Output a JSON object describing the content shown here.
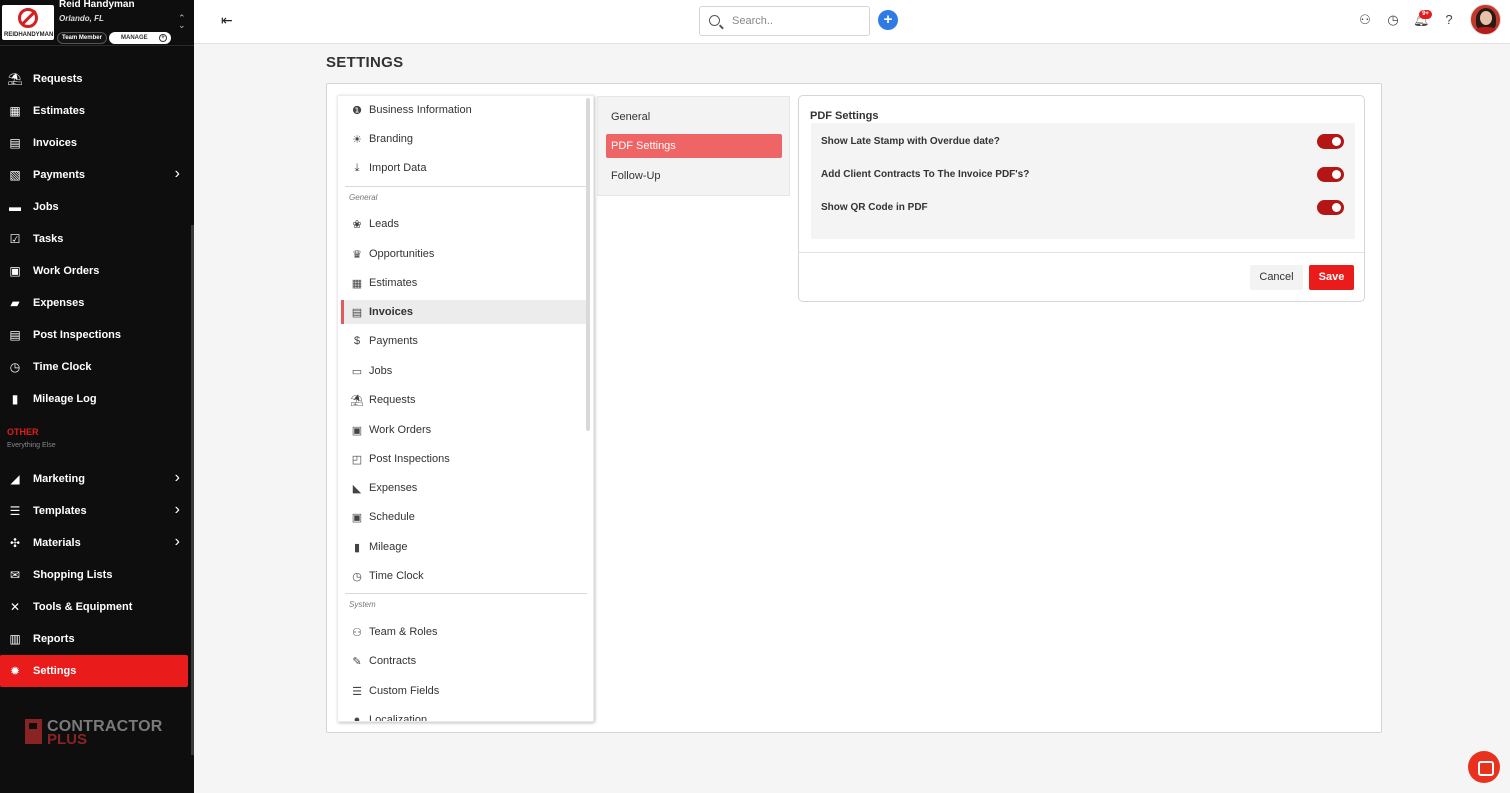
{
  "brand": {
    "business_name": "Reid Handyman",
    "location": "Orlando, FL",
    "role": "Team Member",
    "manage_label": "MANAGE",
    "logo_text": "REIDHANDYMAN"
  },
  "sidebar": {
    "items": [
      {
        "label": "Requests",
        "icon": "requests-icon",
        "glyph": "⛱"
      },
      {
        "label": "Estimates",
        "icon": "estimates-icon",
        "glyph": "▦"
      },
      {
        "label": "Invoices",
        "icon": "invoices-icon",
        "glyph": "▤"
      },
      {
        "label": "Payments",
        "icon": "payments-icon",
        "glyph": "▧",
        "has_submenu": true
      },
      {
        "label": "Jobs",
        "icon": "briefcase-icon",
        "glyph": "▬"
      },
      {
        "label": "Tasks",
        "icon": "checkbox-icon",
        "glyph": "☑"
      },
      {
        "label": "Work Orders",
        "icon": "work-orders-icon",
        "glyph": "▣"
      },
      {
        "label": "Expenses",
        "icon": "expenses-icon",
        "glyph": "▰"
      },
      {
        "label": "Post Inspections",
        "icon": "post-inspections-icon",
        "glyph": "▤"
      },
      {
        "label": "Time Clock",
        "icon": "clock-icon",
        "glyph": "◷"
      },
      {
        "label": "Mileage Log",
        "icon": "fuel-icon",
        "glyph": "▮"
      }
    ],
    "other_label": "OTHER",
    "other_sub": "Everything Else",
    "other_items": [
      {
        "label": "Marketing",
        "icon": "megaphone-icon",
        "glyph": "◢",
        "has_submenu": true
      },
      {
        "label": "Templates",
        "icon": "templates-icon",
        "glyph": "☰",
        "has_submenu": true
      },
      {
        "label": "Materials",
        "icon": "materials-icon",
        "glyph": "✣",
        "has_submenu": true
      },
      {
        "label": "Shopping Lists",
        "icon": "shopping-list-icon",
        "glyph": "✉"
      },
      {
        "label": "Tools & Equipment",
        "icon": "tools-icon",
        "glyph": "✕"
      },
      {
        "label": "Reports",
        "icon": "reports-icon",
        "glyph": "▥"
      },
      {
        "label": "Settings",
        "icon": "gear-icon",
        "glyph": "✹",
        "active": true
      }
    ],
    "footer_logo": {
      "line1": "CONTRACTOR",
      "line2": "PLUS"
    }
  },
  "topbar": {
    "search_placeholder": "Search.."
  },
  "notifications": {
    "badge": "9+"
  },
  "page": {
    "title": "SETTINGS"
  },
  "settings_menu": {
    "top_items": [
      {
        "label": "Business Information",
        "icon": "info-icon",
        "glyph": "❶"
      },
      {
        "label": "Branding",
        "icon": "sun-icon",
        "glyph": "☀"
      },
      {
        "label": "Import Data",
        "icon": "download-icon",
        "glyph": "⤓"
      }
    ],
    "general_label": "General",
    "general_items": [
      {
        "label": "Leads",
        "icon": "leads-icon",
        "glyph": "❀"
      },
      {
        "label": "Opportunities",
        "icon": "trophy-icon",
        "glyph": "♛"
      },
      {
        "label": "Estimates",
        "icon": "estimates-icon",
        "glyph": "▦"
      },
      {
        "label": "Invoices",
        "icon": "invoices-icon",
        "glyph": "▤",
        "active": true
      },
      {
        "label": "Payments",
        "icon": "payments-icon",
        "glyph": "$"
      },
      {
        "label": "Jobs",
        "icon": "briefcase-icon",
        "glyph": "▭"
      },
      {
        "label": "Requests",
        "icon": "requests-icon",
        "glyph": "⛱"
      },
      {
        "label": "Work Orders",
        "icon": "work-orders-icon",
        "glyph": "▣"
      },
      {
        "label": "Post Inspections",
        "icon": "post-inspections-icon",
        "glyph": "◰"
      },
      {
        "label": "Expenses",
        "icon": "expenses-icon",
        "glyph": "◣"
      },
      {
        "label": "Schedule",
        "icon": "calendar-icon",
        "glyph": "▣"
      },
      {
        "label": "Mileage",
        "icon": "fuel-icon",
        "glyph": "▮"
      },
      {
        "label": "Time Clock",
        "icon": "clock-icon",
        "glyph": "◷"
      }
    ],
    "system_label": "System",
    "system_items": [
      {
        "label": "Team & Roles",
        "icon": "team-icon",
        "glyph": "⚇"
      },
      {
        "label": "Contracts",
        "icon": "contract-icon",
        "glyph": "✎"
      },
      {
        "label": "Custom Fields",
        "icon": "lines-icon",
        "glyph": "☰"
      },
      {
        "label": "Localization",
        "icon": "globe-icon",
        "glyph": "●"
      }
    ]
  },
  "invoice_tabs": [
    {
      "label": "General"
    },
    {
      "label": "PDF Settings",
      "active": true
    },
    {
      "label": "Follow-Up"
    }
  ],
  "pdf_settings": {
    "title": "PDF Settings",
    "options": [
      {
        "label": "Show Late Stamp with Overdue date?",
        "enabled": true
      },
      {
        "label": "Add Client Contracts To The Invoice PDF's?",
        "enabled": true
      },
      {
        "label": "Show QR Code in PDF",
        "enabled": true
      }
    ],
    "cancel_label": "Cancel",
    "save_label": "Save"
  }
}
